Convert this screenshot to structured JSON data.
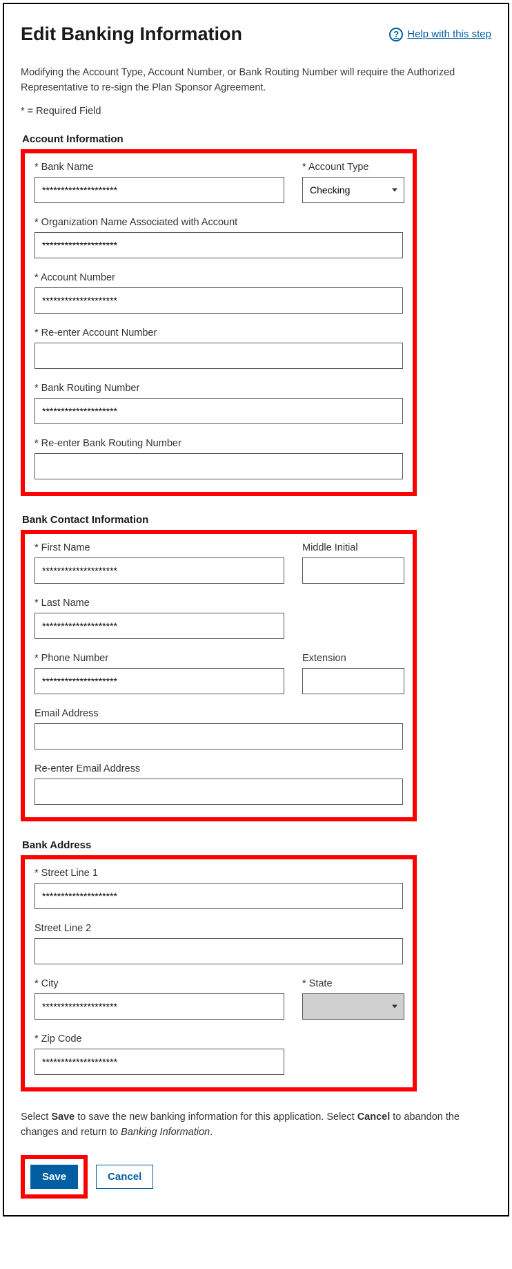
{
  "header": {
    "title": "Edit Banking Information",
    "help_label": " Help with this step"
  },
  "intro": "Modifying the Account Type, Account Number, or Bank Routing Number will require the Authorized Representative to re-sign the Plan Sponsor Agreement.",
  "required_note": "* = Required Field",
  "sections": {
    "account_info": {
      "heading": "Account Information",
      "bank_name": {
        "label": "* Bank Name",
        "value": "********************"
      },
      "account_type": {
        "label": "* Account Type",
        "value": "Checking"
      },
      "org_name": {
        "label": "* Organization Name Associated with Account",
        "value": "********************"
      },
      "account_number": {
        "label": "* Account Number",
        "value": "********************"
      },
      "re_account_number": {
        "label": "* Re-enter Account Number",
        "value": ""
      },
      "routing_number": {
        "label": "* Bank Routing Number",
        "value": "********************"
      },
      "re_routing_number": {
        "label": "* Re-enter Bank Routing Number",
        "value": ""
      }
    },
    "contact_info": {
      "heading": "Bank Contact Information",
      "first_name": {
        "label": "* First Name",
        "value": "********************"
      },
      "middle_initial": {
        "label": "Middle Initial",
        "value": ""
      },
      "last_name": {
        "label": "* Last Name",
        "value": "********************"
      },
      "phone": {
        "label": "* Phone Number",
        "value": "********************"
      },
      "extension": {
        "label": "Extension",
        "value": ""
      },
      "email": {
        "label": "Email Address",
        "value": ""
      },
      "re_email": {
        "label": "Re-enter Email Address",
        "value": ""
      }
    },
    "address": {
      "heading": "Bank Address",
      "street1": {
        "label": "* Street Line 1",
        "value": "********************"
      },
      "street2": {
        "label": "Street Line 2",
        "value": ""
      },
      "city": {
        "label": "* City",
        "value": "********************"
      },
      "state": {
        "label": "* State",
        "value": ""
      },
      "zip": {
        "label": "* Zip Code",
        "value": "********************"
      }
    }
  },
  "footer": {
    "instruction_pre": "Select ",
    "instruction_save": "Save",
    "instruction_mid": " to save the new banking information for this application. Select ",
    "instruction_cancel": "Cancel",
    "instruction_mid2": " to abandon the changes and return to ",
    "instruction_link": "Banking Information",
    "instruction_end": ".",
    "save_label": "Save",
    "cancel_label": "Cancel"
  }
}
